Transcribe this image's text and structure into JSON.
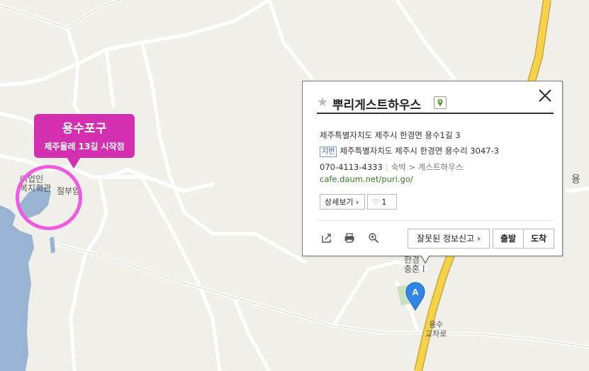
{
  "map": {
    "callout": {
      "line1": "용수포구",
      "line2": "제주올레 13길 시작점"
    },
    "labels": {
      "welfare_line1": "어업인",
      "welfare_line2": "복지회관",
      "temple": "절부암",
      "right_edge": "용",
      "near_pin_line1": "한경",
      "near_pin_line2": "충혼",
      "near_pin_suffix": "I",
      "intersection_line1": "용수",
      "intersection_line2": "교차로"
    },
    "marker_letter": "A",
    "colors": {
      "sea": "#99b4d2",
      "road": "#ffffff",
      "highway": "#f6d24a",
      "callout": "#d42fb1",
      "marker": "#2f86e8"
    }
  },
  "popup": {
    "title": "뿌리게스트하우스",
    "star_icon": "star-icon",
    "address_road": "제주특별자치도 제주시 한경면 용수1길 3",
    "jibun_label": "지번",
    "address_jibun": "제주특별자치도 제주시 한경면 용수리 3047-3",
    "phone": "070-4113-4333",
    "category": "숙박",
    "category_arrow": ">",
    "subcategory": "게스트하우스",
    "url": "cafe.daum.net/puri.go/",
    "detail_button": "상세보기",
    "like_count": "1",
    "report_button": "잘못된 정보신고",
    "depart_button": "출발",
    "arrive_button": "도착"
  }
}
